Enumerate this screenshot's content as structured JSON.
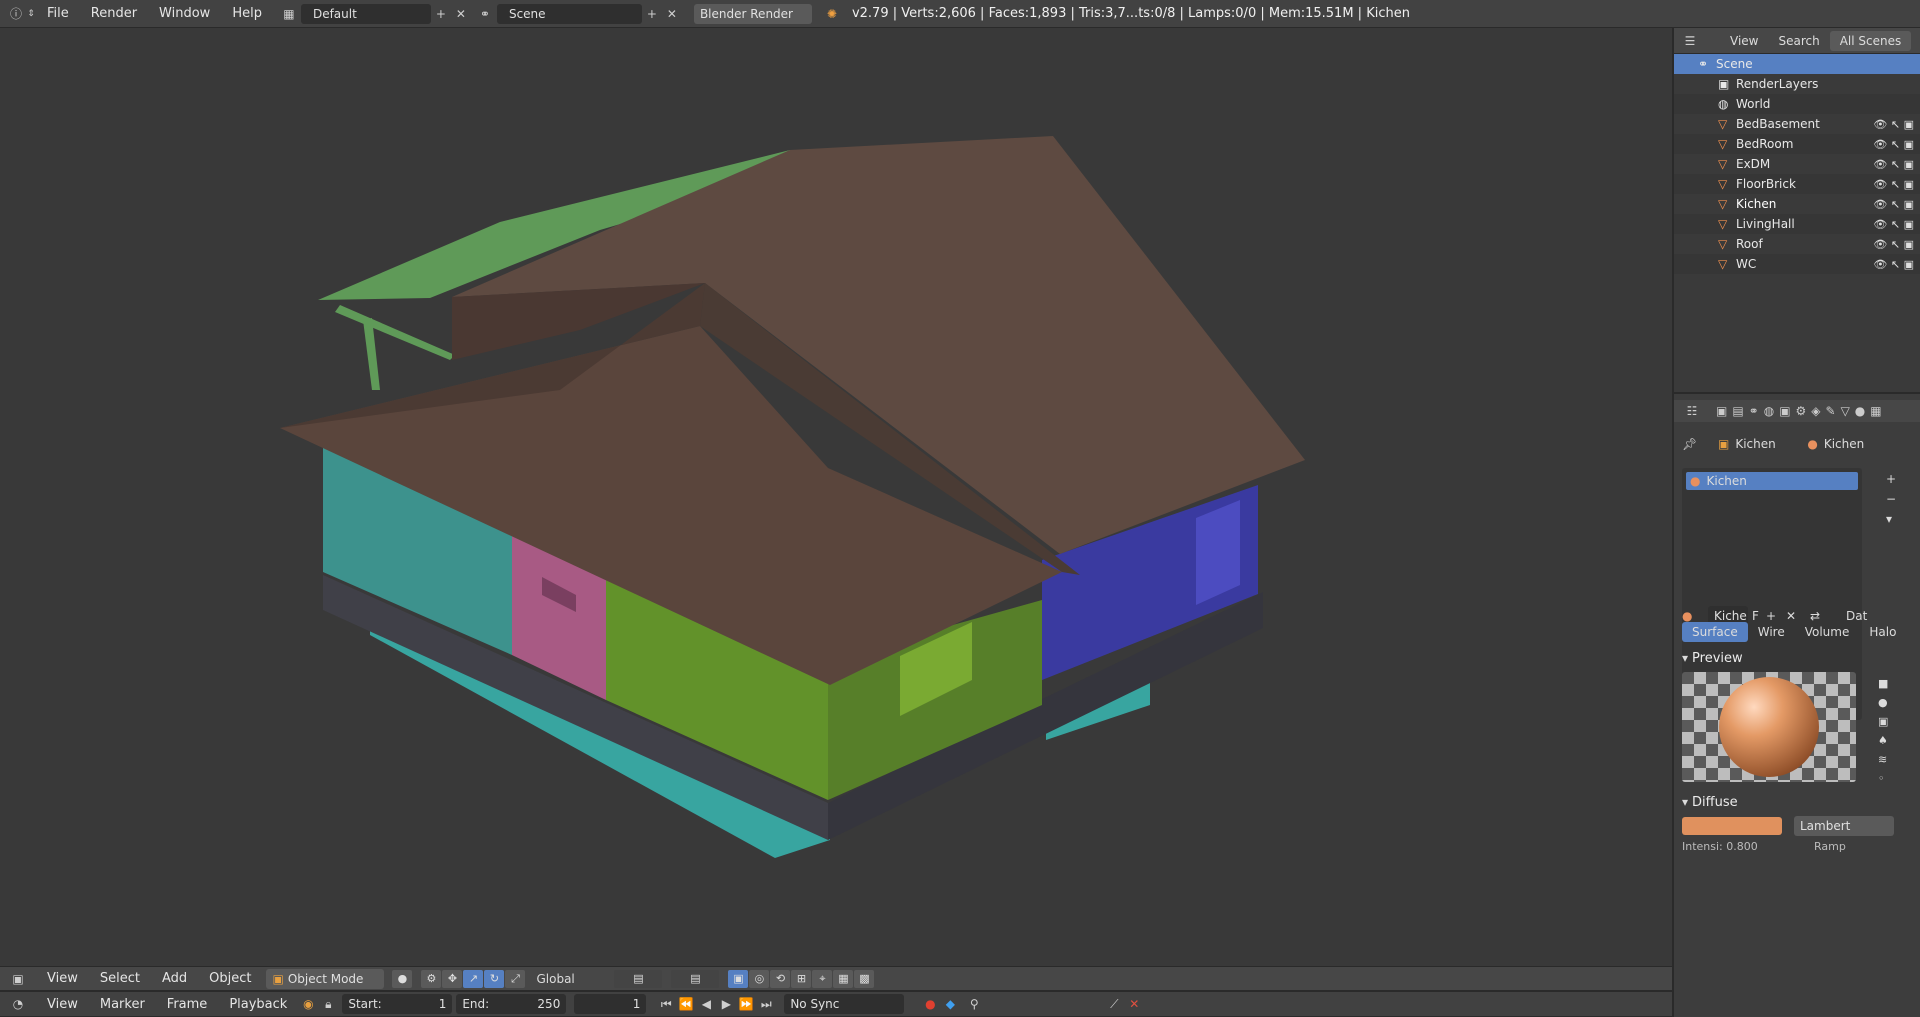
{
  "top_menu": {
    "items": [
      "File",
      "Render",
      "Window",
      "Help"
    ],
    "screen_layout": "Default",
    "scene": "Scene",
    "render_engine": "Blender Render",
    "stats": "v2.79 | Verts:2,606 | Faces:1,893 | Tris:3,7...ts:0/8 | Lamps:0/0 | Mem:15.51M | Kichen"
  },
  "view3d_header": {
    "menus": [
      "View",
      "Select",
      "Add",
      "Object"
    ],
    "mode": "Object Mode",
    "orientation": "Global"
  },
  "timeline": {
    "menus": [
      "View",
      "Marker",
      "Frame",
      "Playback"
    ],
    "start_label": "Start:",
    "start_value": "1",
    "end_label": "End:",
    "end_value": "250",
    "current_frame": "1",
    "sync": "No Sync"
  },
  "outliner": {
    "tabs": [
      "View",
      "Search",
      "All Scenes"
    ],
    "items": [
      {
        "name": "Scene"
      },
      {
        "name": "RenderLayers"
      },
      {
        "name": "World"
      },
      {
        "name": "BedBasement"
      },
      {
        "name": "BedRoom"
      },
      {
        "name": "ExDM"
      },
      {
        "name": "FloorBrick"
      },
      {
        "name": "Kichen"
      },
      {
        "name": "LivingHall"
      },
      {
        "name": "Roof"
      },
      {
        "name": "WC"
      }
    ]
  },
  "properties": {
    "breadcrumb_object": "Kichen",
    "breadcrumb_material": "Kichen",
    "material_slot": "Kichen",
    "material_name": "Kiche",
    "material_users": "F",
    "data_label": "Dat",
    "type_tabs": [
      "Surface",
      "Wire",
      "Volume",
      "Halo"
    ],
    "preview_title": "Preview",
    "diffuse_title": "Diffuse",
    "diffuse_shader": "Lambert",
    "intensity_label": "Intensi: 0.800",
    "ramp_label": "Ramp",
    "diffuse_color": "#e0915e"
  }
}
